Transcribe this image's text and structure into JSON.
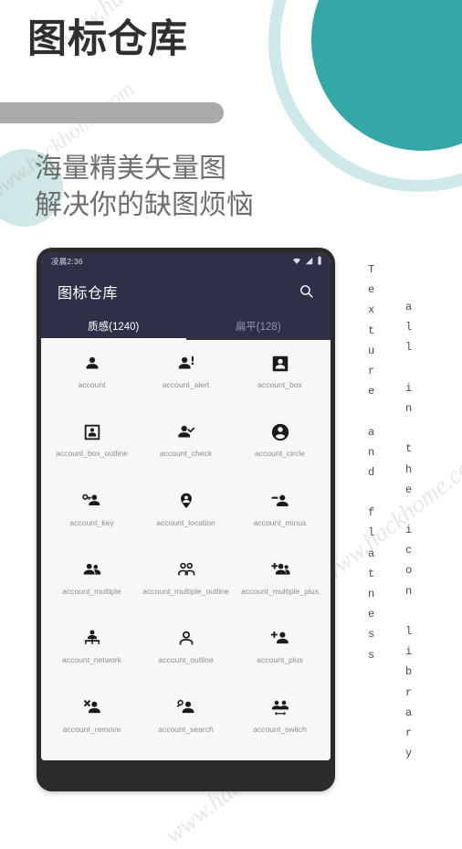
{
  "header": {
    "title": "图标仓库",
    "subtitle_line1": "海量精美矢量图",
    "subtitle_line2": "解决你的缺图烦恼"
  },
  "colors": {
    "teal": "#34a8a8",
    "teal_light": "#cee9e9",
    "app_bar": "#2e3047",
    "rule_gray": "#aaaaaa",
    "label_gray": "#8d8d8d",
    "phone_frame": "#2b2b2b"
  },
  "phone": {
    "status_bar": {
      "time": "凌晨2:36",
      "icons": [
        "wifi-icon",
        "signal-icon",
        "battery-icon"
      ]
    },
    "app_bar": {
      "title": "图标仓库",
      "search_icon": "search-icon"
    },
    "tabs": [
      {
        "label": "质感(1240)",
        "active": true
      },
      {
        "label": "扁平(128)",
        "active": false
      }
    ],
    "icons": [
      {
        "label": "account",
        "glyph": "account-icon"
      },
      {
        "label": "account_alert",
        "glyph": "account-alert-icon"
      },
      {
        "label": "account_box",
        "glyph": "account-box-icon"
      },
      {
        "label": "account_box_outline",
        "glyph": "account-box-outline-icon"
      },
      {
        "label": "account_check",
        "glyph": "account-check-icon"
      },
      {
        "label": "account_circle",
        "glyph": "account-circle-icon"
      },
      {
        "label": "account_key",
        "glyph": "account-key-icon"
      },
      {
        "label": "account_location",
        "glyph": "account-location-icon"
      },
      {
        "label": "account_minus",
        "glyph": "account-minus-icon"
      },
      {
        "label": "account_multiple",
        "glyph": "account-multiple-icon"
      },
      {
        "label": "account_multiple_outline",
        "glyph": "account-multiple-outline-icon"
      },
      {
        "label": "account_multiple_plus",
        "glyph": "account-multiple-plus-icon"
      },
      {
        "label": "account_network",
        "glyph": "account-network-icon"
      },
      {
        "label": "account_outline",
        "glyph": "account-outline-icon"
      },
      {
        "label": "account_plus",
        "glyph": "account-plus-icon"
      },
      {
        "label": "account_remove",
        "glyph": "account-remove-icon"
      },
      {
        "label": "account_search",
        "glyph": "account-search-icon"
      },
      {
        "label": "account_switch",
        "glyph": "account-switch-icon"
      }
    ]
  },
  "side_captions": {
    "left": "T\ne\nx\nt\nu\nr\ne\n\na\nn\nd\n\nf\nl\na\nt\nn\ne\ns\ns",
    "right": "a\nl\nl\n\ni\nn\n\nt\nh\ne\n\ni\nc\no\nn\n\nl\ni\nb\nr\na\nr\ny"
  },
  "watermark": {
    "text": "www.hackhome.com"
  }
}
